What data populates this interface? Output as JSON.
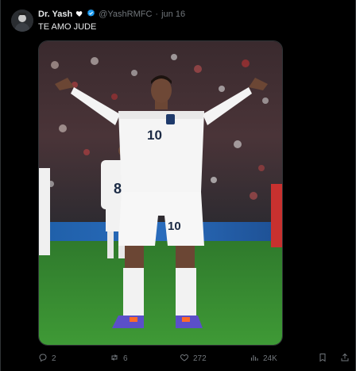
{
  "tweet": {
    "author_name": "Dr. Yash",
    "handle": "@YashRMFC",
    "separator": "·",
    "date": "jun 16",
    "text": "TE AMO JUDE",
    "media": {
      "player_shirt_number": "10",
      "player_shorts_number": "10",
      "background_player_number": "8"
    }
  },
  "actions": {
    "replies": "2",
    "reposts": "6",
    "likes": "272",
    "views": "24K"
  },
  "icons": {
    "heart_emoji": "heart-icon",
    "verified": "verified-badge-icon",
    "reply": "reply-icon",
    "repost": "repost-icon",
    "like": "like-icon",
    "views": "views-icon",
    "bookmark": "bookmark-icon",
    "share": "share-icon"
  },
  "colors": {
    "background": "#000000",
    "text": "#e7e9ea",
    "secondary": "#71767b",
    "verified": "#1d9bf0"
  }
}
